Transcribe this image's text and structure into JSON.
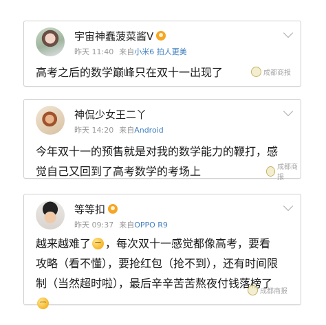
{
  "posts": [
    {
      "username": "宇宙神蠢菠菜酱V",
      "time": "昨天 11:40",
      "source_prefix": "来自",
      "source_device": "小米6 拍人更美",
      "text": "高考之后的数学巅峰只在双十一出现了",
      "watermark": "成都商报"
    },
    {
      "username": "神侃少女王二丫",
      "time": "昨天 14:20",
      "source_prefix": "来自",
      "source_device": "Android",
      "text": "今年双十一的预售就是对我的数学能力的鞭打，感觉自己又回到了高考数学的考场上",
      "watermark": "成都商报"
    },
    {
      "username": "等等扣",
      "time": "昨天 09:37",
      "source_prefix": "来自",
      "source_device": "OPPO R9",
      "text_part1": "越来越难了",
      "text_part2": "，每次双十一感觉都像高考，要看攻略（看不懂），要抢红包（抢不到），还有时间限制（当然超时啦），最后辛辛苦苦熬夜付钱落榜了",
      "watermark": "成都商报"
    }
  ],
  "icons": {
    "avatar": "user-avatar",
    "badge": "vip-badge-icon",
    "menu": "chevron-down-icon",
    "emoji": "smile-emoji-icon",
    "watermark": "newspaper-logo-icon"
  },
  "colors": {
    "source_link": "#3f7fbf",
    "meta_text": "#999999",
    "card_border": "#cfcfcf"
  }
}
